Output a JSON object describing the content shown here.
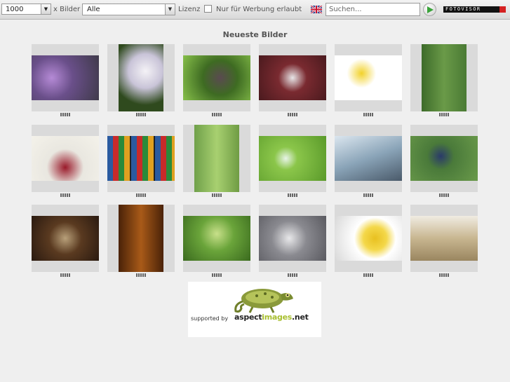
{
  "toolbar": {
    "count_value": "1000",
    "count_suffix": "x Bilder",
    "license_value": "Alle",
    "license_label": "Lizenz",
    "ad_checkbox_label": "Nur für Werbung erlaubt",
    "search_placeholder": "Suchen...",
    "logo_text": "FOTOVISOR"
  },
  "main": {
    "title": "Neueste Bilder"
  },
  "sponsor": {
    "prefix": "supported by",
    "brand_a": "aspect",
    "brand_b": "images",
    "brand_c": ".net"
  },
  "colors": {
    "logo_red": "#d42020",
    "brand_green": "#a8bf2f",
    "tile_bg": "#dadada"
  },
  "icons": {
    "flag": "uk-flag-icon",
    "go": "play-arrow-icon"
  },
  "gallery": {
    "images": [
      {
        "subject": "purple allium flowers",
        "orientation": "landscape"
      },
      {
        "subject": "white flower stamens",
        "orientation": "portrait"
      },
      {
        "subject": "beetle on leaf",
        "orientation": "landscape"
      },
      {
        "subject": "succulent rosette with water drop",
        "orientation": "landscape"
      },
      {
        "subject": "yellow flower sprig",
        "orientation": "landscape"
      },
      {
        "subject": "green grass field",
        "orientation": "portrait"
      },
      {
        "subject": "oil bottle with herbs",
        "orientation": "landscape"
      },
      {
        "subject": "watercolor paint box",
        "orientation": "landscape"
      },
      {
        "subject": "green grass blades",
        "orientation": "portrait"
      },
      {
        "subject": "water drop on leaf",
        "orientation": "landscape"
      },
      {
        "subject": "fountain pen nib on banknote",
        "orientation": "landscape"
      },
      {
        "subject": "damselfly on stem",
        "orientation": "landscape"
      },
      {
        "subject": "dried flowers on wood",
        "orientation": "landscape"
      },
      {
        "subject": "amber liquid drop",
        "orientation": "portrait"
      },
      {
        "subject": "green leaf",
        "orientation": "landscape"
      },
      {
        "subject": "water drop macro",
        "orientation": "landscape"
      },
      {
        "subject": "daisy close-up",
        "orientation": "landscape"
      },
      {
        "subject": "dry grass seeds",
        "orientation": "landscape"
      }
    ]
  }
}
